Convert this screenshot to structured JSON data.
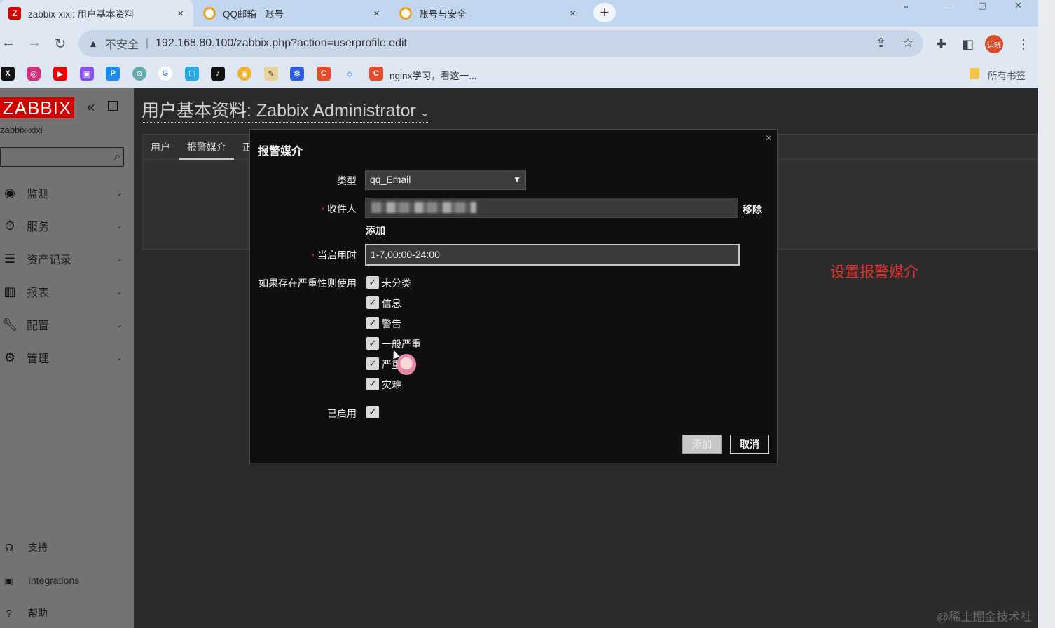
{
  "browser": {
    "tabs": [
      {
        "title": "zabbix-xixi: 用户基本资料",
        "icon": "zabbix-favicon"
      },
      {
        "title": "QQ邮箱 - 账号",
        "icon": "qq-mail-favicon"
      },
      {
        "title": "账号与安全",
        "icon": "qq-mail-favicon"
      }
    ],
    "close_glyph": "×",
    "new_tab_glyph": "+",
    "address": {
      "security_label": "不安全",
      "url": "192.168.80.100/zabbix.php?action=userprofile.edit"
    },
    "profile_label": "边晓",
    "bookmarks": {
      "last_label": "nginx学习，看这一...",
      "all_bookmarks_label": "所有书签"
    }
  },
  "sidebar": {
    "logo": "ZABBIX",
    "server_name": "zabbix-xixi",
    "menu": [
      {
        "label": "监测",
        "icon": "eye-icon"
      },
      {
        "label": "服务",
        "icon": "clock-icon"
      },
      {
        "label": "资产记录",
        "icon": "list-icon"
      },
      {
        "label": "报表",
        "icon": "bar-chart-icon"
      },
      {
        "label": "配置",
        "icon": "wrench-icon"
      },
      {
        "label": "管理",
        "icon": "gear-icon"
      }
    ],
    "footer": [
      {
        "label": "支持",
        "icon": "headset-icon"
      },
      {
        "label": "Integrations",
        "icon": "zabbix-icon"
      },
      {
        "label": "帮助",
        "icon": "help-icon"
      }
    ]
  },
  "main": {
    "title": "用户基本资料: Zabbix Administrator",
    "tabs": [
      "用户",
      "报警媒介",
      "正"
    ],
    "annotation": "设置报警媒介",
    "watermark": "@稀土掘金技术社区"
  },
  "modal": {
    "title": "报警媒介",
    "close_glyph": "×",
    "fields": {
      "type_label": "类型",
      "type_value": "qq_Email",
      "recipient_label": "收件人",
      "recipient_value": "",
      "remove_label": "移除",
      "add_link_label": "添加",
      "when_active_label": "当启用时",
      "when_active_value": "1-7,00:00-24:00",
      "severity_label": "如果存在严重性则使用",
      "severities": [
        {
          "label": "未分类",
          "checked": true
        },
        {
          "label": "信息",
          "checked": true
        },
        {
          "label": "警告",
          "checked": true
        },
        {
          "label": "一般严重",
          "checked": true
        },
        {
          "label": "严重",
          "checked": true
        },
        {
          "label": "灾难",
          "checked": true
        }
      ],
      "enabled_label": "已启用",
      "enabled": true
    },
    "buttons": {
      "add": "添加",
      "cancel": "取消"
    }
  }
}
